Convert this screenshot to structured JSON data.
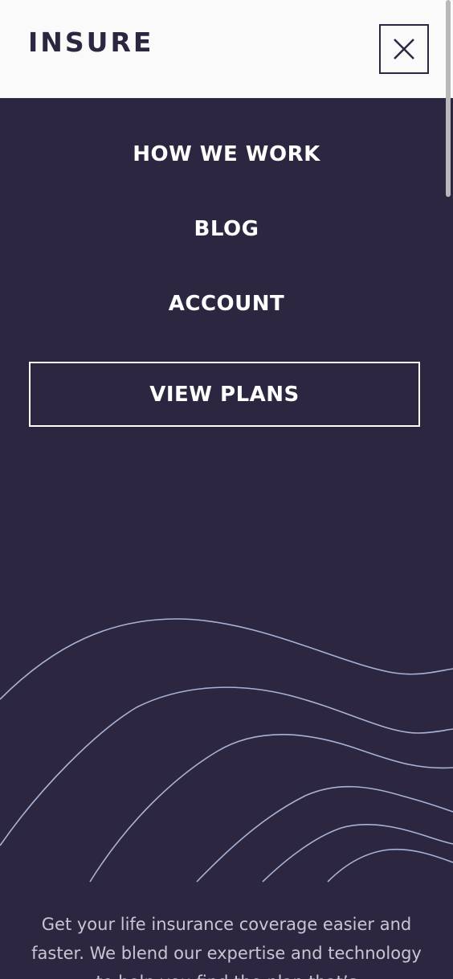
{
  "header": {
    "logo_text": "INSURE",
    "close_icon": "close-icon"
  },
  "nav": {
    "items": [
      {
        "label": "HOW WE WORK"
      },
      {
        "label": "BLOG"
      },
      {
        "label": "ACCOUNT"
      }
    ],
    "cta_label": "VIEW PLANS"
  },
  "hero": {
    "tagline": "Get your life insurance coverage easier and faster. We blend our expertise and technology to help you find the plan that’s"
  },
  "colors": {
    "header_bg": "#fafafa",
    "menu_bg": "#2c2640",
    "text_light": "#ffffff",
    "wave_stroke": "#a9b2d6"
  }
}
